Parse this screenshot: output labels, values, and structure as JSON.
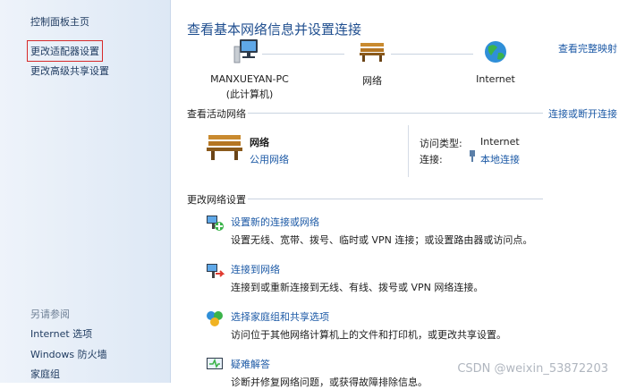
{
  "sidebar": {
    "home": "控制面板主页",
    "adapter": "更改适配器设置",
    "advanced": "更改高级共享设置",
    "see_also": "另请参阅",
    "links": [
      "Internet 选项",
      "Windows 防火墙",
      "家庭组"
    ]
  },
  "header": {
    "title": "查看基本网络信息并设置连接",
    "full_map": "查看完整映射"
  },
  "map": {
    "pc_name": "MANXUEYAN-PC",
    "pc_sub": "(此计算机)",
    "network": "网络",
    "internet": "Internet"
  },
  "active": {
    "heading": "查看活动网络",
    "connect_link": "连接或断开连接",
    "name": "网络",
    "type": "公用网络",
    "access_label": "访问类型:",
    "access_value": "Internet",
    "conn_label": "连接:",
    "conn_value": "本地连接"
  },
  "change": {
    "heading": "更改网络设置",
    "tasks": [
      {
        "title": "设置新的连接或网络",
        "desc": "设置无线、宽带、拨号、临时或 VPN 连接；或设置路由器或访问点。",
        "icon": "new-connection-icon"
      },
      {
        "title": "连接到网络",
        "desc": "连接到或重新连接到无线、有线、拨号或 VPN 网络连接。",
        "icon": "connect-network-icon"
      },
      {
        "title": "选择家庭组和共享选项",
        "desc": "访问位于其他网络计算机上的文件和打印机，或更改共享设置。",
        "icon": "homegroup-icon"
      },
      {
        "title": "疑难解答",
        "desc": "诊断并修复网络问题，或获得故障排除信息。",
        "icon": "troubleshoot-icon"
      }
    ]
  },
  "watermark": "CSDN @weixin_53872203",
  "colors": {
    "link": "#1d5aa6",
    "title": "#1f4e8f",
    "highlight": "#d72a2a"
  }
}
